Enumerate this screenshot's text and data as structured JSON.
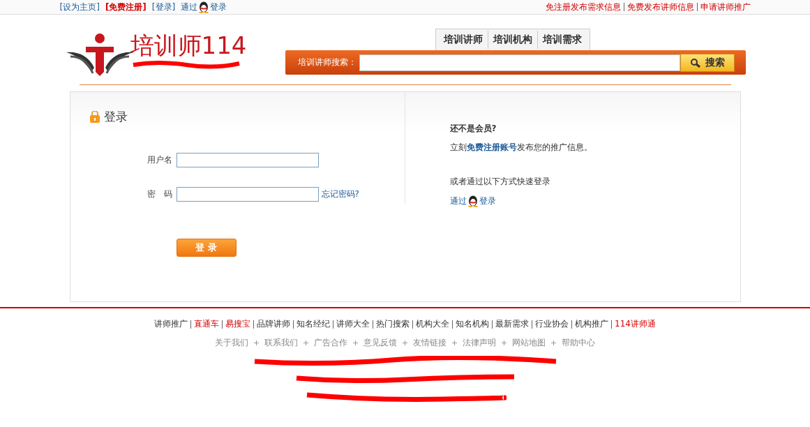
{
  "top_bar": {
    "left_links": [
      {
        "text": "[设为主页]",
        "highlight": false
      },
      {
        "text": "[免费注册]",
        "highlight": true
      },
      {
        "text": "[登录]",
        "highlight": false
      }
    ],
    "qq_login": {
      "prefix": "通过",
      "suffix": "登录"
    },
    "right_links": [
      "免注册发布需求信息",
      "免费发布讲师信息",
      "申请讲师推广"
    ]
  },
  "logo": {
    "title": "培训师114"
  },
  "nav_tabs": [
    {
      "label": "培训讲师"
    },
    {
      "label": "培训机构"
    },
    {
      "label": "培训需求"
    }
  ],
  "search": {
    "label": "培训讲师搜索：",
    "button": "搜索"
  },
  "login": {
    "title": "登录",
    "fields": [
      {
        "label": "用户名"
      },
      {
        "label": "密　码",
        "link": "忘记密码?"
      }
    ],
    "submit": "登 录"
  },
  "register": {
    "question": "还不是会员?",
    "prefix": "立刻",
    "link": "免费注册账号",
    "suffix": "发布您的推广信息。",
    "quick": "或者通过以下方式快速登录",
    "qq_prefix": "通过",
    "qq_suffix": "登录"
  },
  "footer": {
    "links": [
      {
        "text": "讲师推广",
        "highlight": false
      },
      {
        "text": "直通车",
        "highlight": true
      },
      {
        "text": "易搜宝",
        "highlight": true
      },
      {
        "text": "品牌讲师",
        "highlight": false
      },
      {
        "text": "知名经纪",
        "highlight": false
      },
      {
        "text": "讲师大全",
        "highlight": false
      },
      {
        "text": "热门搜索",
        "highlight": false
      },
      {
        "text": "机构大全",
        "highlight": false
      },
      {
        "text": "知名机构",
        "highlight": false
      },
      {
        "text": "最新需求",
        "highlight": false
      },
      {
        "text": "行业协会",
        "highlight": false
      },
      {
        "text": "机构推广",
        "highlight": false
      },
      {
        "text": "114讲师通",
        "highlight": true
      }
    ],
    "info_links": [
      "关于我们",
      "联系我们",
      "广告合作",
      "意见反馈",
      "友情链接",
      "法律声明",
      "网站地图",
      "帮助中心"
    ]
  }
}
